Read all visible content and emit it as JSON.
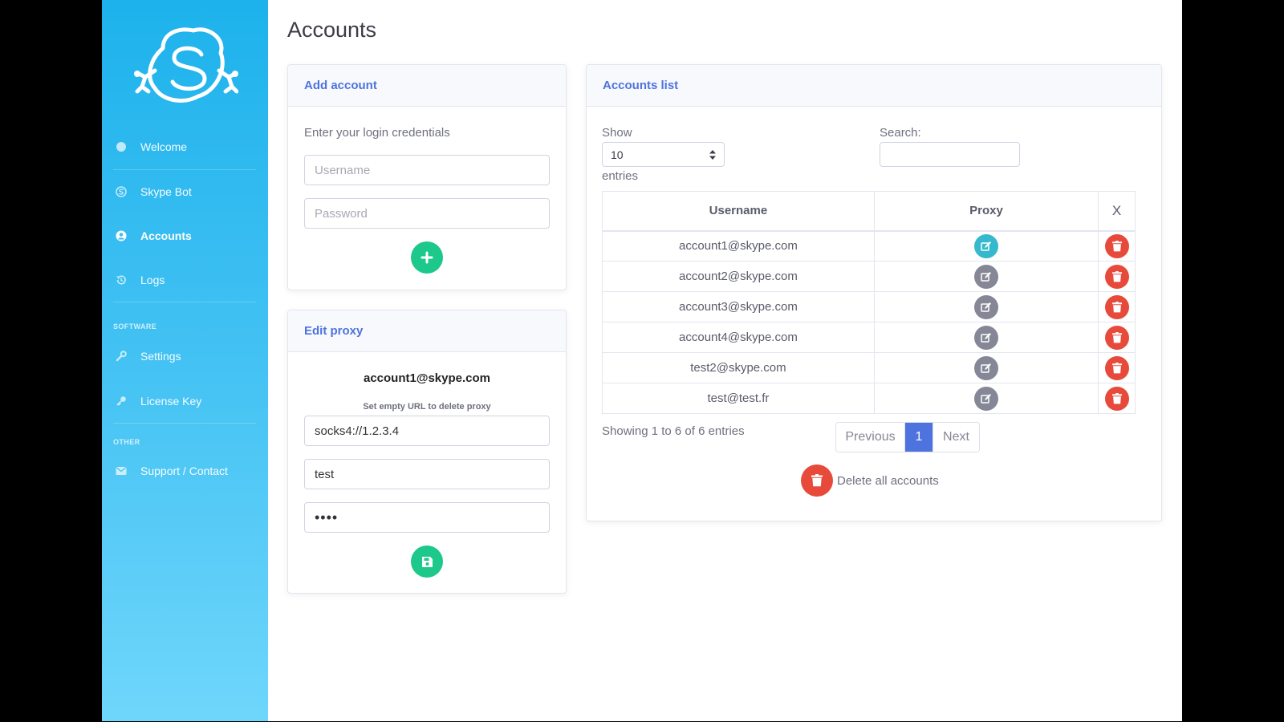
{
  "sidebar": {
    "logo": "skype-bot-logo",
    "items": [
      {
        "label": "Welcome",
        "icon": "circle-icon",
        "active": false
      },
      {
        "label": "Skype Bot",
        "icon": "skype-icon",
        "active": false
      },
      {
        "label": "Accounts",
        "icon": "user-circle-icon",
        "active": true
      },
      {
        "label": "Logs",
        "icon": "history-icon",
        "active": false
      }
    ],
    "software_heading": "SOFTWARE",
    "software_items": [
      {
        "label": "Settings",
        "icon": "wrench-icon"
      },
      {
        "label": "License Key",
        "icon": "key-icon"
      }
    ],
    "other_heading": "OTHER",
    "other_items": [
      {
        "label": "Support / Contact",
        "icon": "envelope-icon"
      }
    ]
  },
  "page": {
    "title": "Accounts"
  },
  "add_account": {
    "title": "Add account",
    "subtitle": "Enter your login credentials",
    "username_placeholder": "Username",
    "password_placeholder": "Password",
    "add_icon": "plus-icon"
  },
  "edit_proxy": {
    "title": "Edit proxy",
    "account": "account1@skype.com",
    "hint": "Set empty URL to delete proxy",
    "proxy_url": "socks4://1.2.3.4",
    "proxy_user": "test",
    "proxy_password": "test",
    "save_icon": "save-icon"
  },
  "accounts_list": {
    "title": "Accounts list",
    "show_label": "Show",
    "entries_value": "10",
    "entries_label": "entries",
    "search_label": "Search:",
    "search_value": "",
    "columns": [
      "Username",
      "Proxy",
      "X"
    ],
    "rows": [
      {
        "username": "account1@skype.com",
        "proxy_selected": true
      },
      {
        "username": "account2@skype.com",
        "proxy_selected": false
      },
      {
        "username": "account3@skype.com",
        "proxy_selected": false
      },
      {
        "username": "account4@skype.com",
        "proxy_selected": false
      },
      {
        "username": "test2@skype.com",
        "proxy_selected": false
      },
      {
        "username": "test@test.fr",
        "proxy_selected": false
      }
    ],
    "info": "Showing 1 to 6 of 6 entries",
    "pagination": {
      "previous": "Previous",
      "current": "1",
      "next": "Next"
    },
    "delete_all_label": "Delete all accounts"
  },
  "colors": {
    "sidebar_top": "#1db2ec",
    "sidebar_bottom": "#6fd6fb",
    "primary": "#4e73df",
    "success": "#1cc88a",
    "danger": "#e74a3b",
    "info": "#36b9cc",
    "secondary": "#858796"
  }
}
